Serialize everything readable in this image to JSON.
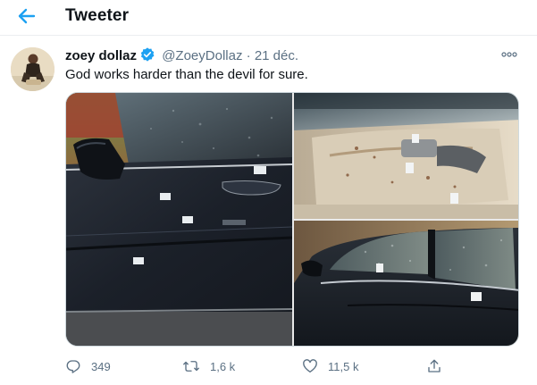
{
  "header": {
    "title": "Tweeter"
  },
  "tweet": {
    "author_name": "zoey dollaz",
    "handle": "@ZoeyDollaz",
    "separator": "·",
    "date": "21 déc.",
    "text": "God works harder than the devil for sure.",
    "verified": true
  },
  "actions": {
    "reply_count": "349",
    "retweet_count": "1,6 k",
    "like_count": "11,5 k"
  },
  "icons": {
    "back": "arrow-left-icon",
    "verified": "verified-badge-icon",
    "more": "more-dots-icon",
    "reply": "reply-icon",
    "retweet": "retweet-icon",
    "like": "heart-icon",
    "share": "share-icon"
  },
  "colors": {
    "accent": "#1da1f2",
    "text_primary": "#0f1419",
    "text_secondary": "#5b7083",
    "divider": "#ebeef0"
  }
}
